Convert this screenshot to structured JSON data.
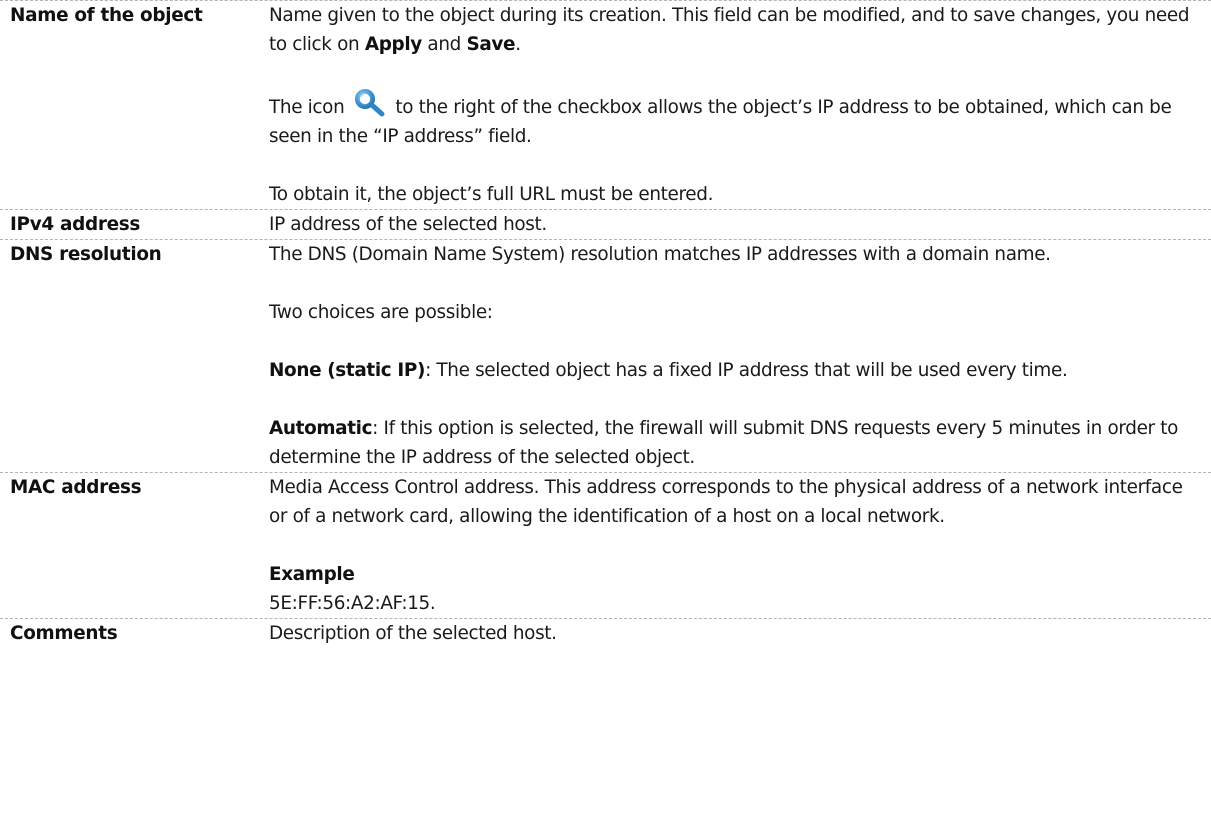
{
  "rows": [
    {
      "label": "Name of the object",
      "p1_a": "Name given to the object during its creation. This field can be modified, and to save changes, you need to click on ",
      "p1_apply": "Apply",
      "p1_and": " and ",
      "p1_save": "Save",
      "p1_end": ".",
      "p2_a": "The icon ",
      "p2_b": " to the right of the checkbox allows the object’s IP address to be obtained, which can be seen in the “IP address” field.",
      "p3": "To obtain it, the object’s full URL must be entered."
    },
    {
      "label": "IPv4 address",
      "p1": "IP address of the selected host."
    },
    {
      "label": "DNS resolution",
      "p1": "The DNS (Domain Name System) resolution matches IP addresses with a domain name.",
      "p2": "Two choices are possible:",
      "p3_kw": "None (static IP)",
      "p3_text": ": The selected object has a fixed IP address that will be used every time.",
      "p4_kw": "Automatic",
      "p4_text": ": If this option is selected, the firewall will submit DNS requests every 5 minutes in order to determine the IP address of the selected object."
    },
    {
      "label": "MAC address",
      "p1": "Media Access Control address. This address corresponds to the physical address of a network interface or of a network card, allowing the identification of a host on a local network.",
      "example_title": "Example",
      "example_value": "5E:FF:56:A2:AF:15."
    },
    {
      "label": "Comments",
      "p1": "Description of the selected host."
    }
  ],
  "icons": {
    "ip_lookup": "magnifier-icon"
  },
  "colors": {
    "icon_blue": "#2f86c7",
    "divider": "#b3b3b3"
  }
}
